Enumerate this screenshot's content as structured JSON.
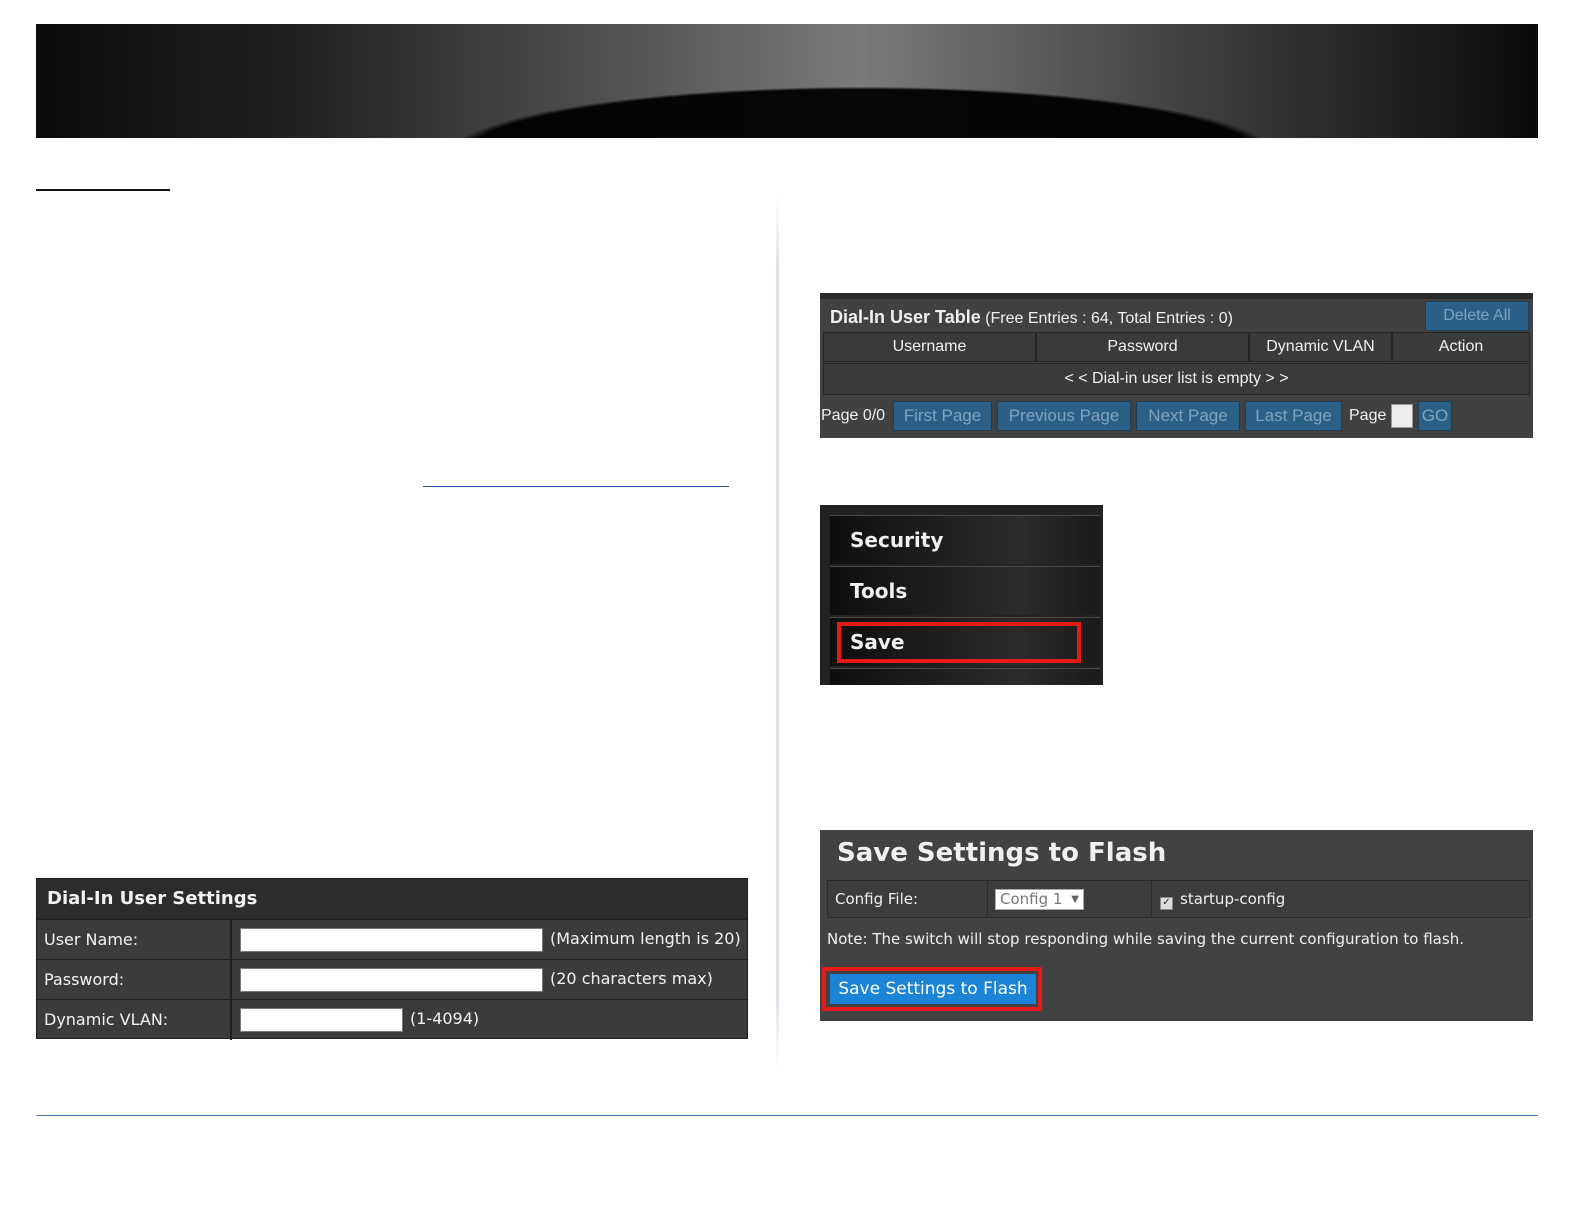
{
  "settings_panel": {
    "title": "Dial-In User Settings",
    "rows": [
      {
        "label": "User Name:",
        "value": "",
        "hint": "(Maximum length is 20)"
      },
      {
        "label": "Password:",
        "value": "",
        "hint": "(20 characters max)"
      },
      {
        "label": "Dynamic VLAN:",
        "value": "",
        "hint": "(1-4094)"
      }
    ]
  },
  "user_table": {
    "title": "Dial-In User Table",
    "entries_info": "(Free Entries : 64, Total Entries : 0)",
    "delete_all": "Delete All",
    "columns": [
      "Username",
      "Password",
      "Dynamic VLAN",
      "Action"
    ],
    "empty_message": "< < Dial-in user list is empty > >",
    "pager": {
      "page_info": "Page 0/0",
      "first": "First Page",
      "previous": "Previous Page",
      "next": "Next Page",
      "last": "Last Page",
      "page_label": "Page",
      "page_value": "",
      "go": "GO"
    }
  },
  "menu": {
    "items": [
      "Security",
      "Tools",
      "Save"
    ],
    "highlighted": "Save",
    "highlight_color": "#e41b1b"
  },
  "flash_panel": {
    "title": "Save Settings to Flash",
    "config_label": "Config File:",
    "config_selected": "Config 1",
    "startup_label": "startup-config",
    "startup_checked": true,
    "note": "Note: The switch will stop responding while saving the current configuration to flash.",
    "button": "Save Settings to Flash",
    "button_color": "#1c84d6"
  }
}
